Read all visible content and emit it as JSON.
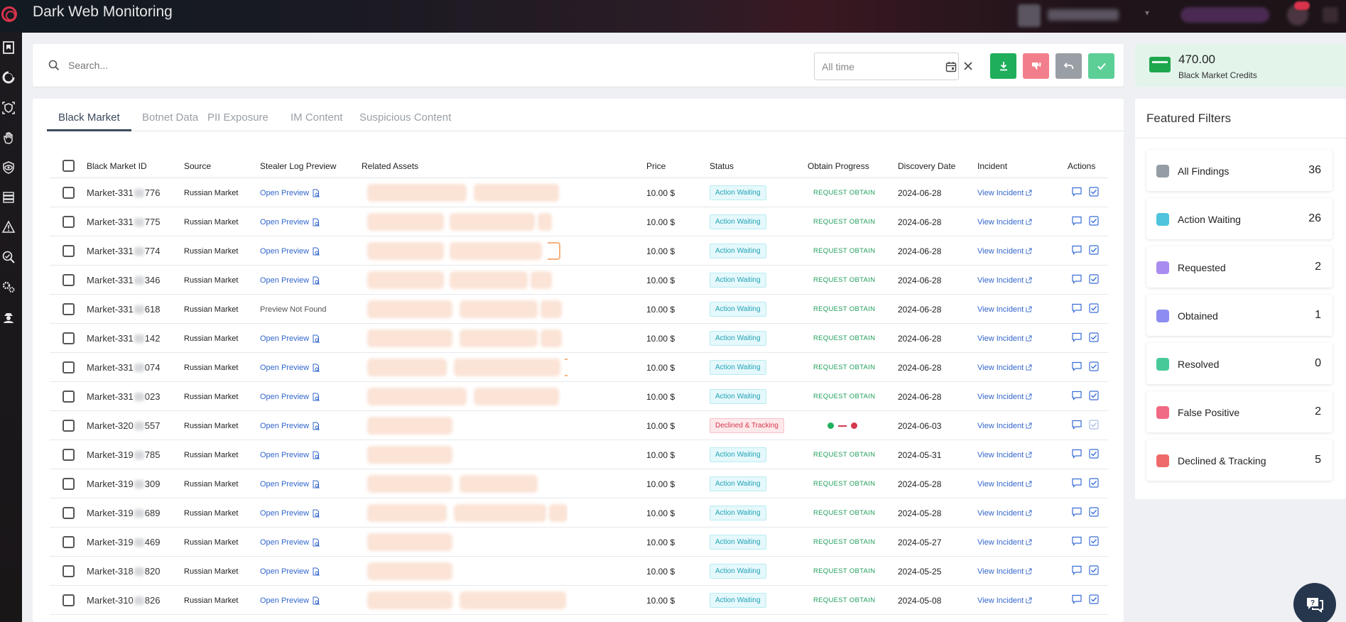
{
  "app": {
    "title": "Dark Web Monitoring"
  },
  "search": {
    "placeholder": "Search..."
  },
  "date_filter": {
    "value": "All time"
  },
  "credits": {
    "amount": "470.00",
    "label": "Black Market Credits"
  },
  "tabs": [
    {
      "label": "Black Market",
      "active": true
    },
    {
      "label": "Botnet Data",
      "active": false
    },
    {
      "label": "PII Exposure",
      "active": false
    },
    {
      "label": "IM Content",
      "active": false
    },
    {
      "label": "Suspicious Content",
      "active": false
    }
  ],
  "columns": [
    "Black Market ID",
    "Source",
    "Stealer Log Preview",
    "Related Assets",
    "Price",
    "Status",
    "Obtain Progress",
    "Discovery Date",
    "Incident",
    "Actions"
  ],
  "rows": [
    {
      "id_prefix": "Market-331",
      "id_suffix": "776",
      "source": "Russian Market",
      "preview": "Open Preview",
      "price": "10.00 $",
      "status": "Action Waiting",
      "obtain": "REQUEST OBTAIN",
      "date": "2024-06-28",
      "incident": "View Incident"
    },
    {
      "id_prefix": "Market-331",
      "id_suffix": "775",
      "source": "Russian Market",
      "preview": "Open Preview",
      "price": "10.00 $",
      "status": "Action Waiting",
      "obtain": "REQUEST OBTAIN",
      "date": "2024-06-28",
      "incident": "View Incident"
    },
    {
      "id_prefix": "Market-331",
      "id_suffix": "774",
      "source": "Russian Market",
      "preview": "Open Preview",
      "price": "10.00 $",
      "status": "Action Waiting",
      "obtain": "REQUEST OBTAIN",
      "date": "2024-06-28",
      "incident": "View Incident"
    },
    {
      "id_prefix": "Market-331",
      "id_suffix": "346",
      "source": "Russian Market",
      "preview": "Open Preview",
      "price": "10.00 $",
      "status": "Action Waiting",
      "obtain": "REQUEST OBTAIN",
      "date": "2024-06-28",
      "incident": "View Incident"
    },
    {
      "id_prefix": "Market-331",
      "id_suffix": "618",
      "source": "Russian Market",
      "preview": "Preview Not Found",
      "price": "10.00 $",
      "status": "Action Waiting",
      "obtain": "REQUEST OBTAIN",
      "date": "2024-06-28",
      "incident": "View Incident"
    },
    {
      "id_prefix": "Market-331",
      "id_suffix": "142",
      "source": "Russian Market",
      "preview": "Open Preview",
      "price": "10.00 $",
      "status": "Action Waiting",
      "obtain": "REQUEST OBTAIN",
      "date": "2024-06-28",
      "incident": "View Incident"
    },
    {
      "id_prefix": "Market-331",
      "id_suffix": "074",
      "source": "Russian Market",
      "preview": "Open Preview",
      "price": "10.00 $",
      "status": "Action Waiting",
      "obtain": "REQUEST OBTAIN",
      "date": "2024-06-28",
      "incident": "View Incident"
    },
    {
      "id_prefix": "Market-331",
      "id_suffix": "023",
      "source": "Russian Market",
      "preview": "Open Preview",
      "price": "10.00 $",
      "status": "Action Waiting",
      "obtain": "REQUEST OBTAIN",
      "date": "2024-06-28",
      "incident": "View Incident"
    },
    {
      "id_prefix": "Market-320",
      "id_suffix": "557",
      "source": "Russian Market",
      "preview": "Open Preview",
      "price": "10.00 $",
      "status": "Declined & Tracking",
      "obtain": "",
      "date": "2024-06-03",
      "incident": "View Incident"
    },
    {
      "id_prefix": "Market-319",
      "id_suffix": "785",
      "source": "Russian Market",
      "preview": "Open Preview",
      "price": "10.00 $",
      "status": "Action Waiting",
      "obtain": "REQUEST OBTAIN",
      "date": "2024-05-31",
      "incident": "View Incident"
    },
    {
      "id_prefix": "Market-319",
      "id_suffix": "309",
      "source": "Russian Market",
      "preview": "Open Preview",
      "price": "10.00 $",
      "status": "Action Waiting",
      "obtain": "REQUEST OBTAIN",
      "date": "2024-05-28",
      "incident": "View Incident"
    },
    {
      "id_prefix": "Market-319",
      "id_suffix": "689",
      "source": "Russian Market",
      "preview": "Open Preview",
      "price": "10.00 $",
      "status": "Action Waiting",
      "obtain": "REQUEST OBTAIN",
      "date": "2024-05-28",
      "incident": "View Incident"
    },
    {
      "id_prefix": "Market-319",
      "id_suffix": "469",
      "source": "Russian Market",
      "preview": "Open Preview",
      "price": "10.00 $",
      "status": "Action Waiting",
      "obtain": "REQUEST OBTAIN",
      "date": "2024-05-27",
      "incident": "View Incident"
    },
    {
      "id_prefix": "Market-318",
      "id_suffix": "820",
      "source": "Russian Market",
      "preview": "Open Preview",
      "price": "10.00 $",
      "status": "Action Waiting",
      "obtain": "REQUEST OBTAIN",
      "date": "2024-05-25",
      "incident": "View Incident"
    },
    {
      "id_prefix": "Market-310",
      "id_suffix": "826",
      "source": "Russian Market",
      "preview": "Open Preview",
      "price": "10.00 $",
      "status": "Action Waiting",
      "obtain": "REQUEST OBTAIN",
      "date": "2024-05-08",
      "incident": "View Incident"
    }
  ],
  "featured_filters": {
    "title": "Featured Filters",
    "items": [
      {
        "label": "All Findings",
        "count": "36",
        "color": "#959ca6"
      },
      {
        "label": "Action Waiting",
        "count": "26",
        "color": "#4fc4dc"
      },
      {
        "label": "Requested",
        "count": "2",
        "color": "#a98cf0"
      },
      {
        "label": "Obtained",
        "count": "1",
        "color": "#8d8cf2"
      },
      {
        "label": "Resolved",
        "count": "0",
        "color": "#48c99a"
      },
      {
        "label": "False Positive",
        "count": "2",
        "color": "#f06a85"
      },
      {
        "label": "Declined & Tracking",
        "count": "5",
        "color": "#ef6a6a"
      }
    ]
  },
  "colors": {
    "download": "#1fae5b",
    "false_positive": "#f37e8b",
    "undo": "#9a9fa6",
    "resolve": "#5ccf97",
    "link": "#3366cc",
    "status_wait": "#22a3b6",
    "status_declined": "#d33a4c"
  },
  "icons": [
    "search-icon",
    "calendar-icon",
    "clear-icon",
    "download-icon",
    "thumbs-down-icon",
    "undo-icon",
    "check-icon",
    "credit-card-icon",
    "file-search-icon",
    "external-link-icon",
    "comment-icon",
    "check-square-icon",
    "help-chat-icon"
  ]
}
